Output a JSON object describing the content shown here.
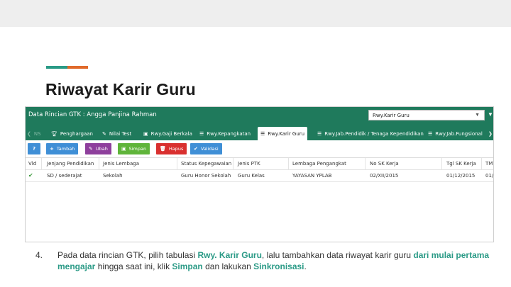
{
  "colors": {
    "header_bg": "#1f7a5c",
    "tab_bg": "#1f7a5c",
    "accent_teal": "#2a9a86",
    "accent_orange": "#e06a2b",
    "btn_help": "#3f8fd6",
    "btn_tambah": "#3f8fd6",
    "btn_ubah": "#8e3f9c",
    "btn_simpan": "#5fb43a",
    "btn_hapus": "#d9302f",
    "btn_validasi": "#3f8fd6"
  },
  "slide": {
    "title": "Riwayat Karir Guru"
  },
  "panel": {
    "title": "Data Rincian GTK : Angga Panjina Rahman",
    "select_value": "Rwy.Karir Guru",
    "select_arrow_icon": "caret-down-icon",
    "header_caret_icon": "caret-down-icon"
  },
  "tabs": [
    {
      "label": "NS",
      "icon": "chevron-left"
    },
    {
      "label": "Penghargaan",
      "icon": "trophy-icon"
    },
    {
      "label": "Nilai Test",
      "icon": "pencil-icon"
    },
    {
      "label": "Rwy.Gaji Berkala",
      "icon": "money-icon"
    },
    {
      "label": "Rwy.Kepangkatan",
      "icon": "list-icon"
    },
    {
      "label": "Rwy.Karir Guru",
      "icon": "list-icon"
    },
    {
      "label": "Rwy.Jab.Pendidik / Tenaga Kependidikan",
      "icon": "list-icon"
    },
    {
      "label": "Rwy.Jab.Fungsional",
      "icon": "list-icon"
    }
  ],
  "toolbar": {
    "help_label": "?",
    "tambah_label": "Tambah",
    "ubah_label": "Ubah",
    "simpan_label": "Simpan",
    "hapus_label": "Hapus",
    "validasi_label": "Validasi"
  },
  "table": {
    "columns": [
      "Vld",
      "Jenjang Pendidikan",
      "Jenis Lembaga",
      "Status Kepegawaian",
      "Jenis PTK",
      "Lembaga Pengangkat",
      "No SK Kerja",
      "Tgl SK Kerja",
      "TMT"
    ],
    "rows": [
      {
        "vld": "✔",
        "jenjang": "SD / sederajat",
        "lembaga": "Sekolah",
        "status": "Guru Honor Sekolah",
        "ptk": "Guru Kelas",
        "pengangkat": "YAYASAN YPLAB",
        "no_sk": "02/XII/2015",
        "tgl_sk": "01/12/2015",
        "tmt": "01/"
      }
    ]
  },
  "instruction": {
    "number": "4.",
    "part1": "Pada data rincian GTK, pilih tabulasi ",
    "hl1": "Rwy. Karir Guru",
    "part2": ", lalu tambahkan data riwayat karir guru ",
    "hl2": "dari mulai pertama mengajar",
    "part3": " hingga saat ini, klik ",
    "hl3": "Simpan",
    "part4": " dan lakukan ",
    "hl4": "Sinkronisasi",
    "part5": "."
  }
}
